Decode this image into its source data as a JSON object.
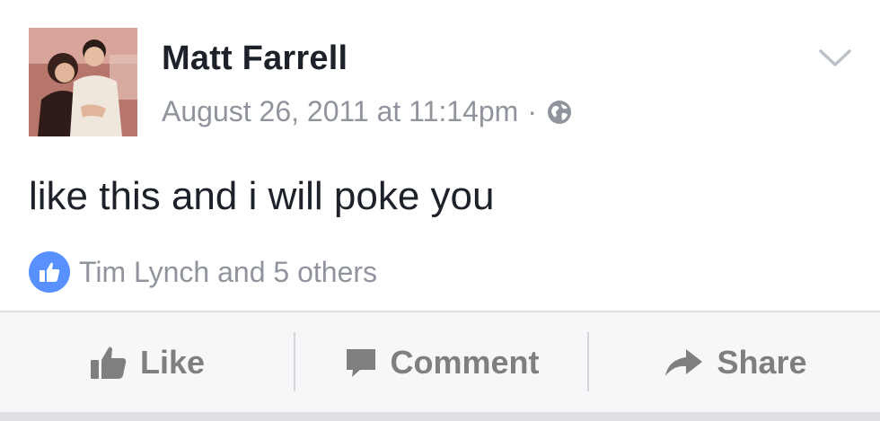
{
  "post": {
    "author_name": "Matt Farrell",
    "timestamp": "August 26, 2011 at 11:14pm",
    "separator": "·",
    "privacy_icon": "globe-icon",
    "menu_icon": "chevron-down-icon",
    "text": "like this and i will poke you"
  },
  "reactions": {
    "icon": "thumbs-up-icon",
    "summary": "Tim Lynch and 5 others"
  },
  "actions": {
    "like_label": "Like",
    "comment_label": "Comment",
    "share_label": "Share"
  },
  "colors": {
    "author": "#1d2129",
    "meta": "#90949c",
    "like_badge": "#5890ff",
    "action_text": "#7f7f7f",
    "action_bar_bg": "#f6f7f9"
  }
}
